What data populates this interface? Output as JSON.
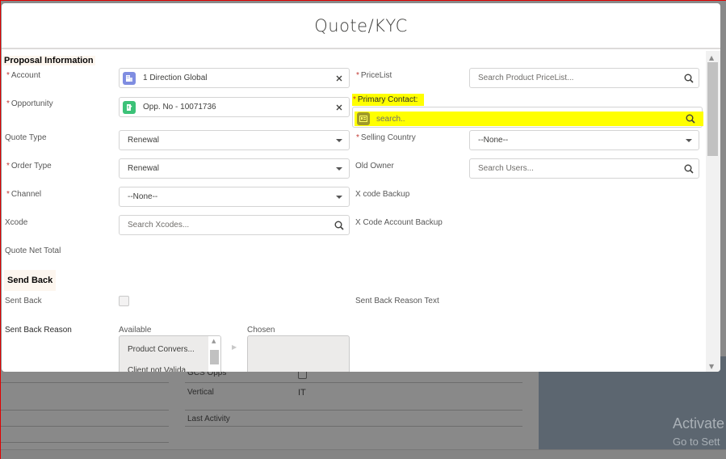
{
  "background": {
    "rows": [
      {
        "label": "GCS Opps",
        "value": ""
      },
      {
        "label": "Vertical",
        "value": "IT"
      },
      {
        "label": "Last Activity",
        "value": ""
      }
    ],
    "watermark": {
      "title": "Activate",
      "subtitle": "Go to Sett"
    }
  },
  "modal": {
    "title": "Quote/KYC",
    "sections": {
      "proposal": "Proposal Information",
      "sendback": "Send Back"
    },
    "fields": {
      "account": {
        "label": "Account",
        "required": "*",
        "value": "1 Direction Global",
        "icon": "account-icon"
      },
      "opportunity": {
        "label": "Opportunity",
        "required": "*",
        "value": "Opp. No - 10071736",
        "icon": "opportunity-icon"
      },
      "quote_type": {
        "label": "Quote Type",
        "value": "Renewal"
      },
      "order_type": {
        "label": "Order Type",
        "required": "*",
        "value": "Renewal"
      },
      "channel": {
        "label": "Channel",
        "required": "*",
        "value": "--None--"
      },
      "xcode": {
        "label": "Xcode",
        "placeholder": "Search Xcodes..."
      },
      "quote_net_total": {
        "label": "Quote Net Total",
        "value": ""
      },
      "pricelist": {
        "label": "PriceList",
        "required": "*",
        "placeholder": "Search Product PriceList..."
      },
      "primary_contact": {
        "label": "Primary Contact:",
        "required": "*",
        "placeholder": "search.."
      },
      "selling_country": {
        "label": "Selling Country",
        "required": "*",
        "value": "--None--"
      },
      "old_owner": {
        "label": "Old Owner",
        "placeholder": "Search Users..."
      },
      "x_code_backup": {
        "label": "X code Backup",
        "value": ""
      },
      "x_code_account_backup": {
        "label": "X Code Account Backup",
        "value": ""
      },
      "sent_back": {
        "label": "Sent Back",
        "checked": false
      },
      "sent_back_reason_text": {
        "label": "Sent Back Reason Text",
        "value": ""
      },
      "sent_back_reason": {
        "label": "Sent Back Reason",
        "available_label": "Available",
        "chosen_label": "Chosen",
        "available_options": [
          "Product Convers...",
          "Client not Valida..."
        ],
        "chosen_options": []
      }
    }
  },
  "colors": {
    "highlight": "#ffff00",
    "required": "#c23934",
    "account_icon": "#7f8de1",
    "opportunity_icon": "#3cc278"
  }
}
